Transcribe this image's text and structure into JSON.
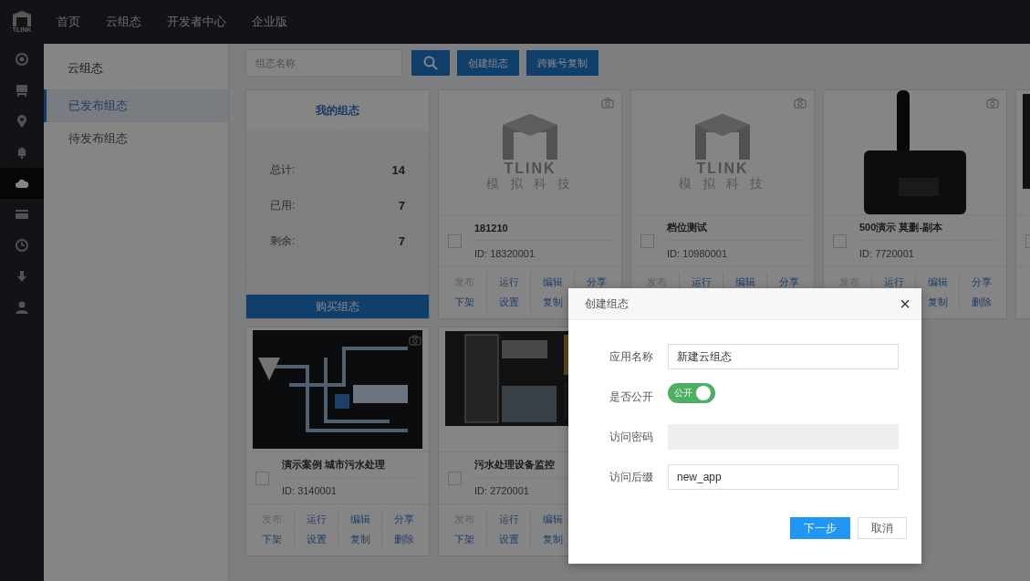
{
  "topbar": {
    "logo_text": "TLINK",
    "nav": [
      "首页",
      "云组态",
      "开发者中心",
      "企业版"
    ]
  },
  "rail": [
    {
      "kind": "target",
      "selected": false
    },
    {
      "kind": "monitor",
      "selected": false
    },
    {
      "kind": "pin",
      "selected": false
    },
    {
      "kind": "bell",
      "selected": false
    },
    {
      "kind": "cloud",
      "selected": true
    },
    {
      "kind": "card",
      "selected": false
    },
    {
      "kind": "clock",
      "selected": false
    },
    {
      "kind": "download",
      "selected": false
    },
    {
      "kind": "user",
      "selected": false
    }
  ],
  "sidebar": {
    "title": "云组态",
    "items": [
      {
        "label": "已发布组态",
        "selected": true
      },
      {
        "label": "待发布组态",
        "selected": false
      }
    ]
  },
  "toolbar": {
    "search": {
      "placeholder": "组态名称"
    },
    "buttons": [
      "创建组态",
      "跨账号复制"
    ]
  },
  "summary": {
    "title": "我的组态",
    "stats": [
      {
        "label": "总计:",
        "value": "14"
      },
      {
        "label": "已用:",
        "value": "7"
      },
      {
        "label": "剩余:",
        "value": "7"
      }
    ],
    "button": "购买组态"
  },
  "cards": [
    {
      "image": {
        "kind": "logo",
        "title": "TLINK",
        "subtitle": "模 拟 科 技"
      },
      "camera": true,
      "name": "181210",
      "id_label": "ID:",
      "id": "18320001",
      "checked": false,
      "action_rows": [
        {
          "kind": "leading",
          "items": [
            {
              "label": "发布",
              "disabled": true
            },
            {
              "label": "运行",
              "disabled": false
            },
            {
              "label": "编辑",
              "disabled": false
            },
            {
              "label": "分享",
              "disabled": false
            }
          ]
        },
        {
          "kind": "leading",
          "items": [
            {
              "label": "下架",
              "disabled": false
            },
            {
              "label": "设置",
              "disabled": false
            },
            {
              "label": "复制",
              "disabled": false
            }
          ]
        }
      ]
    },
    {
      "image": {
        "kind": "logo",
        "title": "TLINK",
        "subtitle": "模 拟 科 技"
      },
      "camera": true,
      "name": "档位测试",
      "id_label": "ID:",
      "id": "10980001",
      "checked": false,
      "action_rows": [
        {
          "kind": "leading",
          "items": [
            {
              "label": "发布",
              "disabled": true
            },
            {
              "label": "运行",
              "disabled": false
            },
            {
              "label": "编辑",
              "disabled": false
            },
            {
              "label": "分享",
              "disabled": false
            }
          ]
        }
      ]
    },
    {
      "image": {
        "kind": "device"
      },
      "camera": true,
      "name": "500演示 莫删-副本",
      "id_label": "ID:",
      "id": "7720001",
      "checked": false,
      "action_rows": [
        {
          "kind": "leading",
          "items": [
            {
              "label": "发布",
              "disabled": true
            },
            {
              "label": "运行",
              "disabled": false
            },
            {
              "label": "编辑",
              "disabled": false
            },
            {
              "label": "分享",
              "disabled": false
            }
          ]
        },
        {
          "kind": "trailing",
          "items": [
            {
              "label": "复制",
              "disabled": false
            },
            {
              "label": "删除",
              "disabled": false
            }
          ]
        }
      ]
    },
    {
      "image": {
        "kind": "dashboard"
      },
      "camera": false,
      "checked": false
    },
    {
      "image": {
        "kind": "diagram"
      },
      "camera": true,
      "name": "演示案例 城市污水处理",
      "id_label": "ID:",
      "id": "3140001",
      "checked": false,
      "action_rows": [
        {
          "kind": "leading",
          "items": [
            {
              "label": "发布",
              "disabled": true
            },
            {
              "label": "运行",
              "disabled": false
            },
            {
              "label": "编辑",
              "disabled": false
            },
            {
              "label": "分享",
              "disabled": false
            }
          ]
        },
        {
          "kind": "leading",
          "items": [
            {
              "label": "下架",
              "disabled": false
            },
            {
              "label": "设置",
              "disabled": false
            },
            {
              "label": "复制",
              "disabled": false
            },
            {
              "label": "删除",
              "disabled": false
            }
          ]
        }
      ]
    },
    {
      "image": {
        "kind": "dashboard"
      },
      "camera": false,
      "name": "污水处理设备监控",
      "id_label": "ID:",
      "id": "2720001",
      "checked": false,
      "action_rows": [
        {
          "kind": "leading",
          "items": [
            {
              "label": "发布",
              "disabled": true
            },
            {
              "label": "运行",
              "disabled": false
            },
            {
              "label": "编辑",
              "disabled": false
            }
          ]
        },
        {
          "kind": "leading",
          "items": [
            {
              "label": "下架",
              "disabled": false
            },
            {
              "label": "设置",
              "disabled": false
            },
            {
              "label": "复制",
              "disabled": false
            }
          ]
        }
      ]
    }
  ],
  "dialog": {
    "title": "创建组态",
    "close": "×",
    "fields": [
      {
        "kind": "text",
        "label": "应用名称",
        "value": "新建云组态",
        "disabled": false
      },
      {
        "kind": "toggle",
        "label": "是否公开",
        "on": true,
        "text": "公开"
      },
      {
        "kind": "text",
        "label": "访问密码",
        "disabled": true
      },
      {
        "kind": "text",
        "label": "访问后缀",
        "value": "new_app",
        "disabled": false
      }
    ],
    "buttons": [
      {
        "label": "下一步",
        "primary": true
      },
      {
        "label": "取消",
        "primary": false
      }
    ]
  }
}
